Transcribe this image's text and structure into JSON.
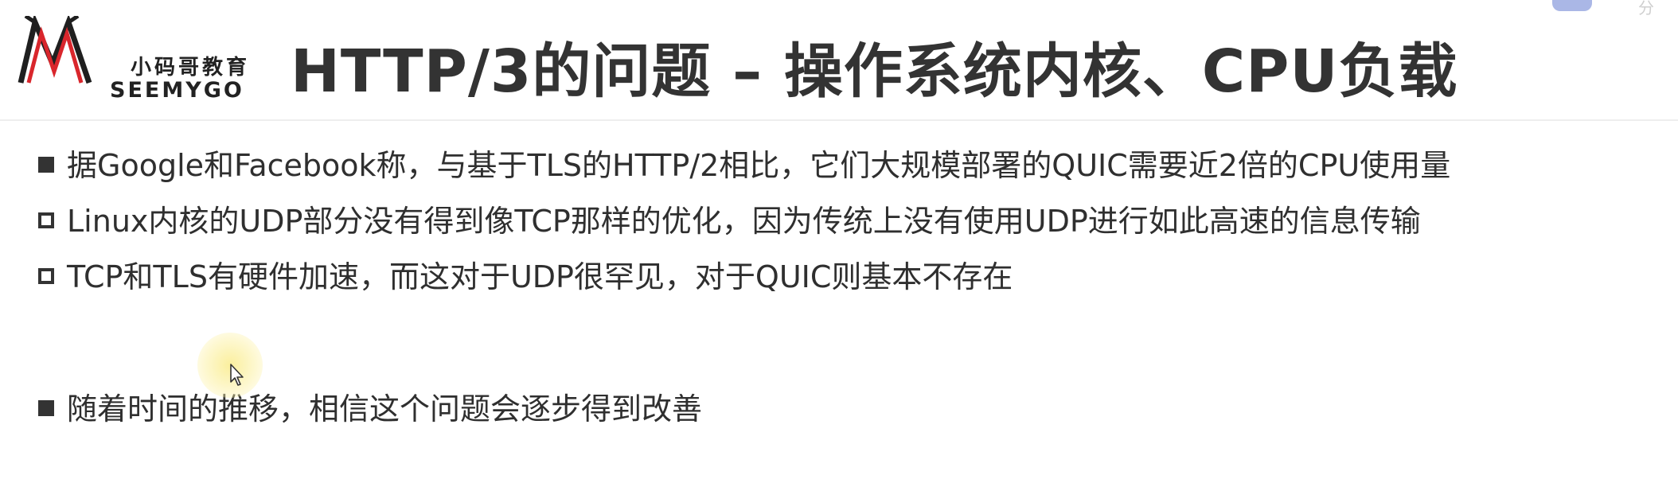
{
  "logo": {
    "cn": "小码哥教育",
    "en": "SEEMYGO"
  },
  "title": "HTTP/3的问题 – 操作系统内核、CPU负载",
  "corner_text": "分",
  "bullets": [
    {
      "marker": "filled",
      "text": "据Google和Facebook称，与基于TLS的HTTP/2相比，它们大规模部署的QUIC需要近2倍的CPU使用量"
    },
    {
      "marker": "hollow",
      "text": "Linux内核的UDP部分没有得到像TCP那样的优化，因为传统上没有使用UDP进行如此高速的信息传输"
    },
    {
      "marker": "hollow",
      "text": "TCP和TLS有硬件加速，而这对于UDP很罕见，对于QUIC则基本不存在"
    },
    {
      "marker": "filled",
      "text": "随着时间的推移，相信这个问题会逐步得到改善"
    }
  ],
  "colors": {
    "title": "#333333",
    "body_text": "#2f2f2f",
    "logo_red": "#d9262c"
  },
  "icons": {
    "cursor": "mouse-pointer-icon",
    "logo_mark": "seemygo-logo-mark"
  }
}
